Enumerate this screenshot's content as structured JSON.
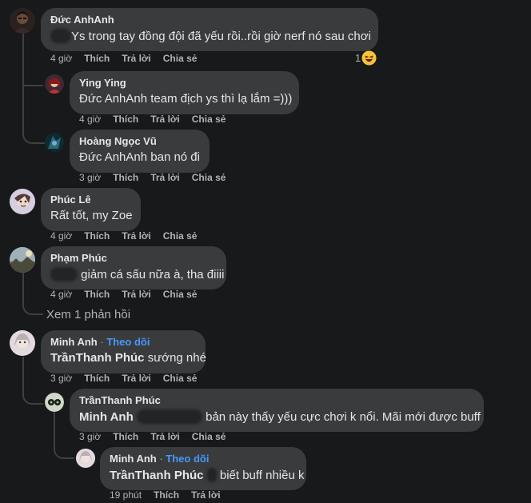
{
  "comments": [
    {
      "author": "Đức AnhAnh",
      "text": "Ys trong tay đồng đội đã yếu rồi..rồi giờ nerf nó sau chơi",
      "time": "4 giờ",
      "like": "Thích",
      "reply": "Trả lời",
      "share": "Chia sẻ",
      "reaction_count": "1",
      "reaction_icon": "laughing-emoji"
    },
    {
      "author": "Ying Ying",
      "mention": "Đức AnhAnh",
      "text": "team địch ys thì lạ lắm =)))",
      "time": "4 giờ",
      "like": "Thích",
      "reply": "Trả lời",
      "share": "Chia sẻ"
    },
    {
      "author": "Hoàng Ngọc Vũ",
      "mention": "Đức AnhAnh",
      "text": "ban nó đi",
      "time": "3 giờ",
      "like": "Thích",
      "reply": "Trả lời",
      "share": "Chia sẻ"
    },
    {
      "author": "Phúc Lê",
      "text": "Rất tốt, my Zoe",
      "time": "4 giờ",
      "like": "Thích",
      "reply": "Trả lời",
      "share": "Chia sẻ"
    },
    {
      "author": "Phạm Phúc",
      "text": "giảm cá sấu nữa à, tha điiii",
      "time": "4 giờ",
      "like": "Thích",
      "reply": "Trả lời",
      "share": "Chia sẻ"
    },
    {
      "author": "Minh Anh",
      "follow": "Theo dõi",
      "mention": "TrầnThanh Phúc",
      "text": "sướng nhé",
      "time": "3 giờ",
      "like": "Thích",
      "reply": "Trả lời",
      "share": "Chia sẻ"
    },
    {
      "author": "TrầnThanh Phúc",
      "mention": "Minh Anh",
      "text": "bản này thấy yếu cực chơi k nổi. Mãi mới được buff",
      "time": "3 giờ",
      "like": "Thích",
      "reply": "Trả lời",
      "share": "Chia sẻ"
    },
    {
      "author": "Minh Anh",
      "follow": "Theo dõi",
      "mention": "TrầnThanh Phúc",
      "text": "biết buff nhiều k",
      "time": "19 phút",
      "like": "Thích",
      "reply": "Trả lời"
    }
  ],
  "view_replies": "Xem 1 phản hồi",
  "colors": {
    "background": "#18191a",
    "bubble": "#3a3b3c",
    "follow_link": "#4599ff",
    "secondary_text": "#b0b3b8"
  }
}
